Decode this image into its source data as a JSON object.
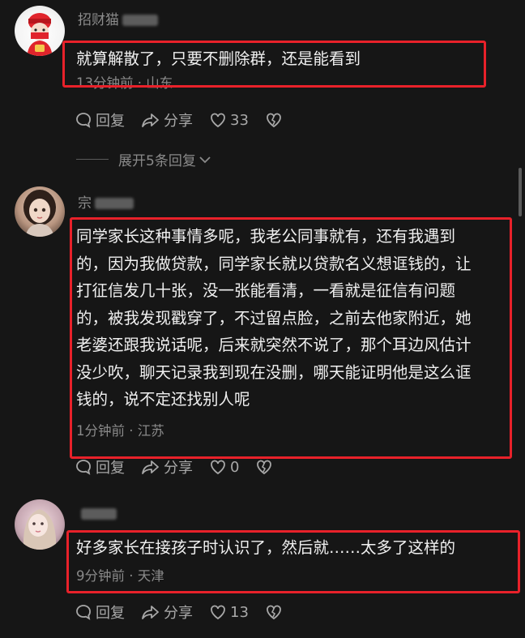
{
  "comments": [
    {
      "username": "招财猫",
      "text": "就算解散了，只要不删除群，还是能看到",
      "time": "13分钟前",
      "location": "山东",
      "reply_label": "回复",
      "share_label": "分享",
      "likes": "33",
      "expand_label": "展开5条回复"
    },
    {
      "username": "宗",
      "text": "同学家长这种事情多呢，我老公同事就有，还有我遇到\n的，因为我做贷款，同学家长就以贷款名义想诓钱的，让\n打征信发几十张，没一张能看清，一看就是征信有问题\n的，被我发现戳穿了，不过留点脸，之前去他家附近，她\n老婆还跟我说话呢，后来就突然不说了，那个耳边风估计\n没少吹，聊天记录我到现在没删，哪天能证明他是这么诓\n钱的，说不定还找别人呢",
      "time": "1分钟前",
      "location": "江苏",
      "reply_label": "回复",
      "share_label": "分享",
      "likes": "0"
    },
    {
      "username": "",
      "text": "好多家长在接孩子时认识了，然后就……太多了这样的",
      "time": "9分钟前",
      "location": "天津",
      "reply_label": "回复",
      "share_label": "分享",
      "likes": "13"
    }
  ],
  "meta_separator": "·",
  "colors": {
    "background": "#161616",
    "highlight_box": "#e8212a",
    "muted_text": "#8a8a8a"
  },
  "icons": [
    "reply-icon",
    "share-icon",
    "like-icon",
    "dislike-icon",
    "chevron-down-icon"
  ]
}
